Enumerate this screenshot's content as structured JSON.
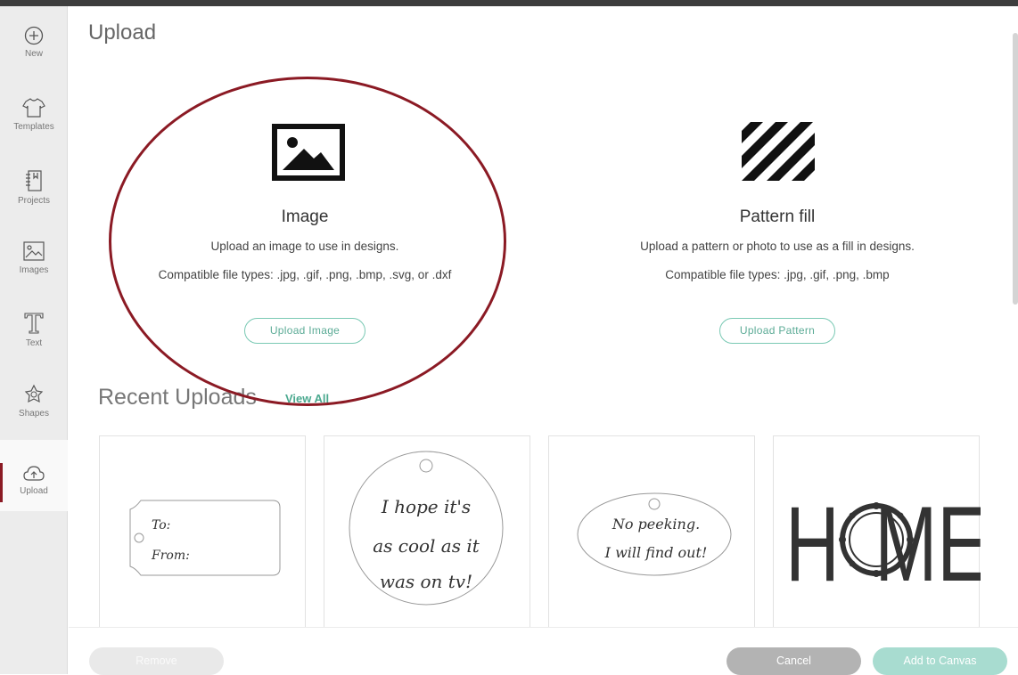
{
  "sidebar": {
    "items": [
      {
        "label": "New",
        "icon": "plus-circle-icon"
      },
      {
        "label": "Templates",
        "icon": "tshirt-icon"
      },
      {
        "label": "Projects",
        "icon": "notebook-icon"
      },
      {
        "label": "Images",
        "icon": "image-icon"
      },
      {
        "label": "Text",
        "icon": "text-t-icon"
      },
      {
        "label": "Shapes",
        "icon": "shapes-icon"
      },
      {
        "label": "Upload",
        "icon": "cloud-upload-icon"
      }
    ],
    "active": "Upload"
  },
  "page": {
    "title": "Upload"
  },
  "image_option": {
    "title": "Image",
    "description": "Upload an image to use in designs.",
    "file_types": "Compatible file types: .jpg, .gif, .png, .bmp, .svg, or .dxf",
    "button": "Upload Image",
    "icon": "picture-frame-icon"
  },
  "pattern_option": {
    "title": "Pattern fill",
    "description": "Upload a pattern or photo to use as a fill in designs.",
    "file_types": "Compatible file types: .jpg, .gif, .png, .bmp",
    "button": "Upload Pattern",
    "icon": "diagonal-stripes-icon"
  },
  "recent": {
    "title": "Recent Uploads",
    "view_all": "View All",
    "items": [
      {
        "lines": [
          "To:",
          "From:"
        ]
      },
      {
        "lines": [
          "I hope it's",
          "as cool as it",
          "was on tv!"
        ]
      },
      {
        "lines": [
          "No peeking.",
          "I will find out!"
        ]
      },
      {
        "lines": [
          "H",
          "ME"
        ]
      }
    ]
  },
  "footer": {
    "remove": "Remove",
    "cancel": "Cancel",
    "add_to_canvas": "Add to Canvas"
  },
  "colors": {
    "accent": "#7ac9b4",
    "highlight_oval": "#8b1a24",
    "cancel_bg": "#b3b3b3",
    "add_bg": "#a8dcd0",
    "remove_bg": "#e9e9e9"
  }
}
